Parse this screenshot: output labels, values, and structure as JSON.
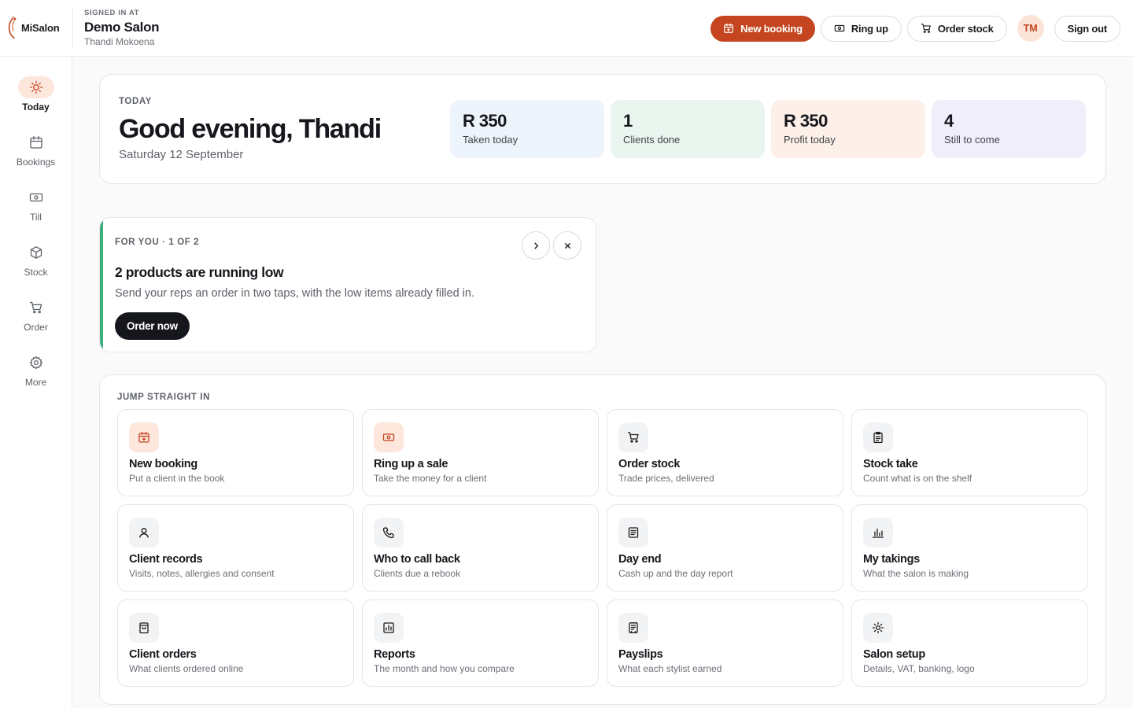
{
  "brand": {
    "name": "MiSalon",
    "accent": "#c4451f"
  },
  "header": {
    "signed_in_label": "SIGNED IN AT",
    "salon_name": "Demo Salon",
    "user_name": "Thandi Mokoena",
    "actions": {
      "new_booking": "New booking",
      "ring_up": "Ring up",
      "order_stock": "Order stock",
      "avatar_initials": "TM",
      "sign_out": "Sign out"
    }
  },
  "sidebar": {
    "items": [
      {
        "label": "Today",
        "icon": "sun-icon",
        "active": true
      },
      {
        "label": "Bookings",
        "icon": "calendar-icon"
      },
      {
        "label": "Till",
        "icon": "cash-icon"
      },
      {
        "label": "Stock",
        "icon": "box-icon"
      },
      {
        "label": "Order",
        "icon": "cart-icon"
      },
      {
        "label": "More",
        "icon": "gear-icon"
      }
    ]
  },
  "today": {
    "label": "TODAY",
    "greeting": "Good evening, Thandi",
    "date": "Saturday 12 September",
    "stats": [
      {
        "value": "R 350",
        "label": "Taken today",
        "color": "#eef4fc"
      },
      {
        "value": "1",
        "label": "Clients done",
        "color": "#e9f5ee"
      },
      {
        "value": "R 350",
        "label": "Profit today",
        "color": "#fdf0e8"
      },
      {
        "value": "4",
        "label": "Still to come",
        "color": "#f1eefb"
      }
    ]
  },
  "for_you": {
    "tag": "FOR YOU · 1 OF 2",
    "title": "2 products are running low",
    "text": "Send your reps an order in two taps, with the low items already filled in.",
    "button": "Order now"
  },
  "jump": {
    "label": "JUMP STRAIGHT IN",
    "tiles": [
      {
        "title": "New booking",
        "sub": "Put a client in the book",
        "icon": "calendar-plus-icon"
      },
      {
        "title": "Ring up a sale",
        "sub": "Take the money for a client",
        "icon": "cash-icon"
      },
      {
        "title": "Order stock",
        "sub": "Trade prices, delivered",
        "icon": "cart-icon"
      },
      {
        "title": "Stock take",
        "sub": "Count what is on the shelf",
        "icon": "clipboard-icon"
      },
      {
        "title": "Client records",
        "sub": "Visits, notes, allergies and consent",
        "icon": "user-icon"
      },
      {
        "title": "Who to call back",
        "sub": "Clients due a rebook",
        "icon": "phone-icon"
      },
      {
        "title": "Day end",
        "sub": "Cash up and the day report",
        "icon": "document-icon"
      },
      {
        "title": "My takings",
        "sub": "What the salon is making",
        "icon": "bar-chart-icon"
      },
      {
        "title": "Client orders",
        "sub": "What clients ordered online",
        "icon": "shopping-bag-icon"
      },
      {
        "title": "Reports",
        "sub": "The month and how you compare",
        "icon": "report-icon"
      },
      {
        "title": "Payslips",
        "sub": "What each stylist earned",
        "icon": "receipt-icon"
      },
      {
        "title": "Salon setup",
        "sub": "Details, VAT, banking, logo",
        "icon": "gear-icon"
      }
    ]
  }
}
